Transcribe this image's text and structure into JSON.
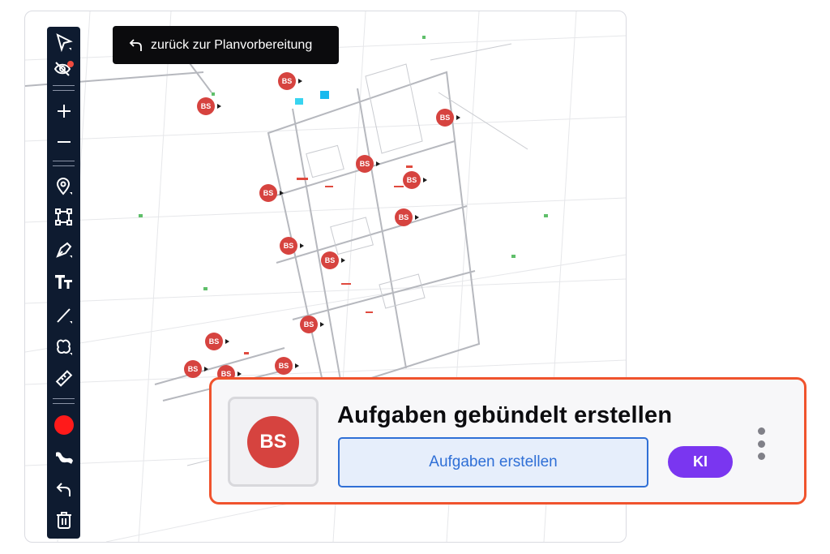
{
  "back_button": {
    "label": "zurück zur Planvorbereitung",
    "icon": "undo-arrow-icon"
  },
  "toolbar": {
    "tools": [
      {
        "name": "select-tool",
        "icon": "cursor-arrow-icon"
      },
      {
        "name": "visibility-toggle",
        "icon": "eye-slash-icon",
        "badge_color": "#ef4b3f"
      },
      {
        "name": "zoom-in",
        "icon": "plus-icon"
      },
      {
        "name": "zoom-out",
        "icon": "minus-icon"
      },
      {
        "name": "pin-tool",
        "icon": "map-pin-icon"
      },
      {
        "name": "area-tool",
        "icon": "vector-square-icon"
      },
      {
        "name": "pen-tool",
        "icon": "pen-nib-icon"
      },
      {
        "name": "text-tool",
        "icon": "text-size-icon"
      },
      {
        "name": "line-tool",
        "icon": "line-icon"
      },
      {
        "name": "cloud-tool",
        "icon": "cloud-shape-icon"
      },
      {
        "name": "measure-tool",
        "icon": "ruler-icon"
      },
      {
        "name": "color-picker",
        "icon": "color-dot-icon",
        "color": "#ff1a1a"
      },
      {
        "name": "stroke-tool",
        "icon": "brush-stroke-icon"
      },
      {
        "name": "undo",
        "icon": "undo-arrow-icon"
      },
      {
        "name": "delete",
        "icon": "trash-icon"
      }
    ]
  },
  "markers": {
    "label": "BS",
    "color": "#d6433f"
  },
  "card": {
    "title": "Aufgaben gebündelt erstellen",
    "marker_label": "BS",
    "create_button": "Aufgaben erstellen",
    "ki_button": "KI",
    "border_color": "#f0532d",
    "accent_color": "#2f6fd6",
    "ki_color": "#7a36f0"
  }
}
